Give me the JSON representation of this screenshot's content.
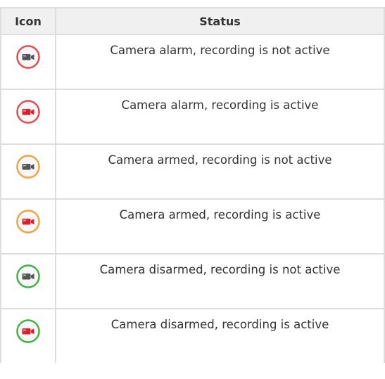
{
  "table": {
    "headers": {
      "icon": "Icon",
      "status": "Status"
    },
    "rows": [
      {
        "status": "Camera alarm, recording is not active",
        "icon": "camera-alarm-not-recording-icon",
        "ring_color": "#e5484d",
        "camera_color": "#555555"
      },
      {
        "status": "Camera alarm, recording is active",
        "icon": "camera-alarm-recording-icon",
        "ring_color": "#e5484d",
        "camera_color": "#d9202b"
      },
      {
        "status": "Camera armed, recording is not active",
        "icon": "camera-armed-not-recording-icon",
        "ring_color": "#f3a13a",
        "camera_color": "#555555"
      },
      {
        "status": "Camera armed, recording is active",
        "icon": "camera-armed-recording-icon",
        "ring_color": "#f3a13a",
        "camera_color": "#d9202b"
      },
      {
        "status": "Camera disarmed, recording is not active",
        "icon": "camera-disarmed-not-recording-icon",
        "ring_color": "#3db33d",
        "camera_color": "#555555"
      },
      {
        "status": "Camera disarmed, recording is active",
        "icon": "camera-disarmed-recording-icon",
        "ring_color": "#3db33d",
        "camera_color": "#d9202b"
      }
    ]
  }
}
